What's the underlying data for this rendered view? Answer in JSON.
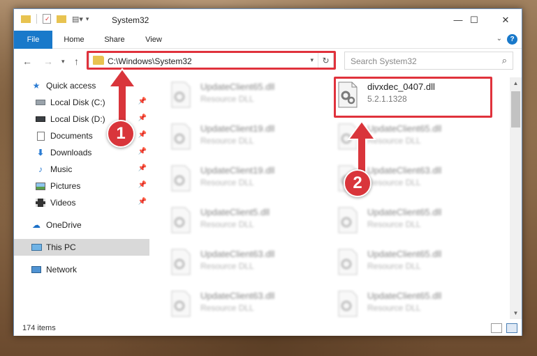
{
  "window": {
    "title": "System32",
    "controls": {
      "minimize": "—",
      "maximize": "☐",
      "close": "✕"
    }
  },
  "ribbon": {
    "tabs": [
      {
        "label": "File",
        "active": true
      },
      {
        "label": "Home"
      },
      {
        "label": "Share"
      },
      {
        "label": "View"
      }
    ],
    "help": "?"
  },
  "address_bar": {
    "path": "C:\\Windows\\System32",
    "search_placeholder": "Search System32"
  },
  "sidebar": {
    "items": [
      {
        "label": "Quick access",
        "icon": "star-icon",
        "pinned": false
      },
      {
        "label": "Local Disk (C:)",
        "icon": "drive-icon",
        "pinned": true
      },
      {
        "label": "Local Disk (D:)",
        "icon": "drive-icon",
        "pinned": true
      },
      {
        "label": "Documents",
        "icon": "documents-icon",
        "pinned": true
      },
      {
        "label": "Downloads",
        "icon": "download-icon",
        "pinned": true
      },
      {
        "label": "Music",
        "icon": "music-icon",
        "pinned": true
      },
      {
        "label": "Pictures",
        "icon": "pictures-icon",
        "pinned": true
      },
      {
        "label": "Videos",
        "icon": "videos-icon",
        "pinned": true
      },
      {
        "label": "OneDrive",
        "icon": "cloud-icon",
        "pinned": false
      },
      {
        "label": "This PC",
        "icon": "computer-icon",
        "pinned": false,
        "selected": true
      },
      {
        "label": "Network",
        "icon": "network-icon",
        "pinned": false
      }
    ]
  },
  "files": {
    "left_column": [
      {
        "name": "UpdateClient65.dll",
        "desc": "Resource DLL"
      },
      {
        "name": "UpdateClient19.dll",
        "desc": "Resource DLL"
      },
      {
        "name": "UpdateClient19.dll",
        "desc": "Resource DLL"
      },
      {
        "name": "UpdateClient5.dll",
        "desc": "Resource DLL"
      },
      {
        "name": "UpdateClient63.dll",
        "desc": "Resource DLL"
      },
      {
        "name": "UpdateClient63.dll",
        "desc": "Resource DLL"
      }
    ],
    "highlighted": {
      "name": "divxdec_0407.dll",
      "desc": "5.2.1.1328"
    },
    "right_column": [
      {
        "name": "UpdateClient65.dll",
        "desc": "Resource DLL"
      },
      {
        "name": "UpdateClient63.dll",
        "desc": "Resource DLL"
      },
      {
        "name": "UpdateClient65.dll",
        "desc": "Resource DLL"
      },
      {
        "name": "UpdateClient65.dll",
        "desc": "Resource DLL"
      },
      {
        "name": "UpdateClient65.dll",
        "desc": "Resource DLL"
      }
    ]
  },
  "status": {
    "item_count": "174 items"
  },
  "annotations": {
    "badge1": "1",
    "badge2": "2",
    "color": "#d9353b"
  },
  "colors": {
    "accent": "#1979ca",
    "highlight": "#e0323c",
    "folder": "#e8c350"
  }
}
